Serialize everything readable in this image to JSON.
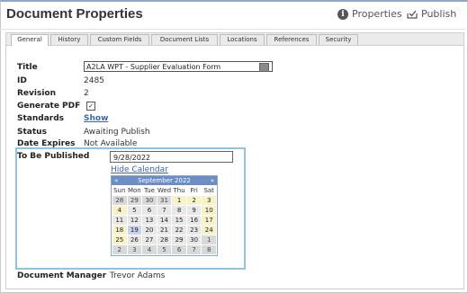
{
  "header": {
    "title": "Document Properties",
    "properties_label": "Properties",
    "publish_label": "Publish"
  },
  "tabs": [
    "General",
    "History",
    "Custom Fields",
    "Document Lists",
    "Locations",
    "References",
    "Security"
  ],
  "active_tab": "General",
  "fields": {
    "title_label": "Title",
    "title_value": "A2LA WPT - Supplier Evaluation Form",
    "id_label": "ID",
    "id_value": "2485",
    "revision_label": "Revision",
    "revision_value": "2",
    "generate_pdf_label": "Generate PDF",
    "generate_pdf_checked": true,
    "standards_label": "Standards",
    "standards_link": "Show",
    "status_label": "Status",
    "status_value": "Awaiting Publish",
    "date_expires_label": "Date Expires",
    "date_expires_value": "Not Available",
    "to_be_published_label": "To Be Published",
    "to_be_published_value": "9/28/2022",
    "hide_calendar_label": "Hide Calendar",
    "document_manager_label": "Document Manager",
    "document_manager_value": "Trevor Adams"
  },
  "calendar": {
    "prev": "«",
    "next": "»",
    "month_label": "September 2022",
    "days_of_week": [
      "Sun",
      "Mon",
      "Tue",
      "Wed",
      "Thu",
      "Fri",
      "Sat"
    ],
    "weeks": [
      [
        "28",
        "29",
        "30",
        "31",
        "1",
        "2",
        "3"
      ],
      [
        "4",
        "5",
        "6",
        "7",
        "8",
        "9",
        "10"
      ],
      [
        "11",
        "12",
        "13",
        "14",
        "15",
        "16",
        "17"
      ],
      [
        "18",
        "19",
        "20",
        "21",
        "22",
        "23",
        "24"
      ],
      [
        "25",
        "26",
        "27",
        "28",
        "29",
        "30",
        "1"
      ],
      [
        "2",
        "3",
        "4",
        "5",
        "6",
        "7",
        "8"
      ]
    ],
    "outside_month_days": [
      [
        0,
        0
      ],
      [
        0,
        1
      ],
      [
        0,
        2
      ],
      [
        0,
        3
      ],
      [
        4,
        6
      ],
      [
        5,
        0
      ],
      [
        5,
        1
      ],
      [
        5,
        2
      ],
      [
        5,
        3
      ],
      [
        5,
        4
      ],
      [
        5,
        5
      ],
      [
        5,
        6
      ]
    ],
    "current_month_days": [
      [
        0,
        4
      ],
      [
        0,
        5
      ],
      [
        0,
        6
      ],
      [
        1,
        0
      ],
      [
        1,
        6
      ],
      [
        2,
        6
      ],
      [
        3,
        0
      ],
      [
        3,
        6
      ],
      [
        4,
        0
      ]
    ],
    "selected_day": [
      3,
      1
    ]
  }
}
